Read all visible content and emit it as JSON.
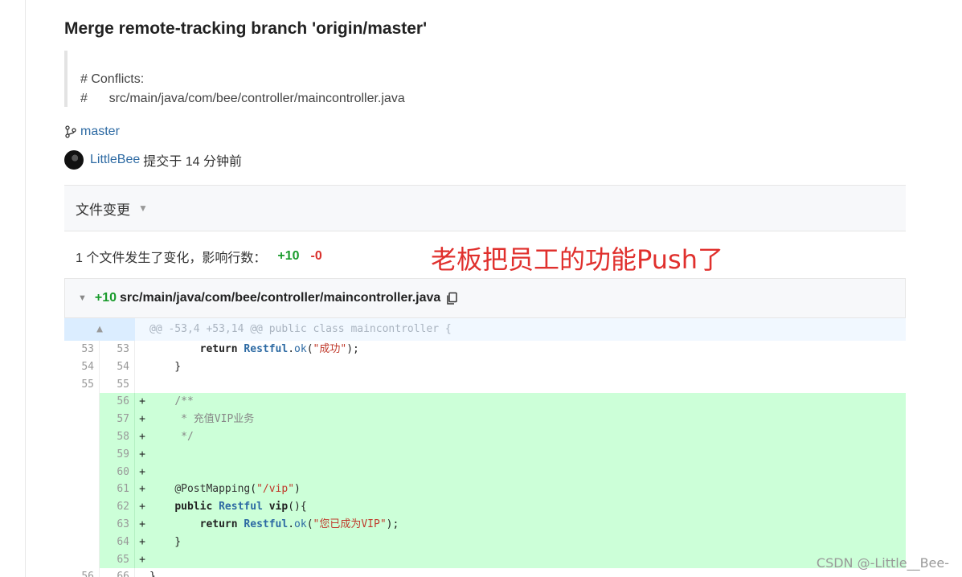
{
  "commit": {
    "title": "Merge remote-tracking branch 'origin/master'",
    "message_lines": [
      "# Conflicts:",
      "#\tsrc/main/java/com/bee/controller/maincontroller.java"
    ],
    "branch": "master",
    "author": "LittleBee",
    "meta": "提交于 14 分钟前"
  },
  "files_bar": {
    "label": "文件变更"
  },
  "summary": {
    "text": "1 个文件发生了变化，影响行数：",
    "additions": "+10",
    "deletions": "-0"
  },
  "annotation": "老板把员工的功能Push了",
  "file": {
    "additions": "+10",
    "path": "src/main/java/com/bee/controller/maincontroller.java"
  },
  "diff": {
    "hunk_header": "@@ -53,4 +53,14 @@ public class maincontroller {",
    "rows": [
      {
        "old": "53",
        "new": "53",
        "sign": "",
        "type": "context",
        "code": "        return Restful.ok(\"成功\");"
      },
      {
        "old": "54",
        "new": "54",
        "sign": "",
        "type": "context",
        "code": "    }"
      },
      {
        "old": "55",
        "new": "55",
        "sign": "",
        "type": "context",
        "code": ""
      },
      {
        "old": "",
        "new": "56",
        "sign": "+",
        "type": "add",
        "code": "    /**"
      },
      {
        "old": "",
        "new": "57",
        "sign": "+",
        "type": "add",
        "code": "     * 充值VIP业务"
      },
      {
        "old": "",
        "new": "58",
        "sign": "+",
        "type": "add",
        "code": "     */"
      },
      {
        "old": "",
        "new": "59",
        "sign": "+",
        "type": "add",
        "code": ""
      },
      {
        "old": "",
        "new": "60",
        "sign": "+",
        "type": "add",
        "code": ""
      },
      {
        "old": "",
        "new": "61",
        "sign": "+",
        "type": "add",
        "code": "    @PostMapping(\"/vip\")"
      },
      {
        "old": "",
        "new": "62",
        "sign": "+",
        "type": "add",
        "code": "    public Restful vip(){"
      },
      {
        "old": "",
        "new": "63",
        "sign": "+",
        "type": "add",
        "code": "        return Restful.ok(\"您已成为VIP\");"
      },
      {
        "old": "",
        "new": "64",
        "sign": "+",
        "type": "add",
        "code": "    }"
      },
      {
        "old": "",
        "new": "65",
        "sign": "+",
        "type": "add",
        "code": ""
      },
      {
        "old": "56",
        "new": "66",
        "sign": "",
        "type": "context",
        "code": "}"
      }
    ]
  },
  "watermark": "CSDN @-Little__Bee-",
  "colors": {
    "addition": "#1a9b2c",
    "deletion": "#d9302c",
    "added_line_bg": "#ccffd8",
    "link": "#2d6aa3",
    "annotation": "#e0302d"
  }
}
